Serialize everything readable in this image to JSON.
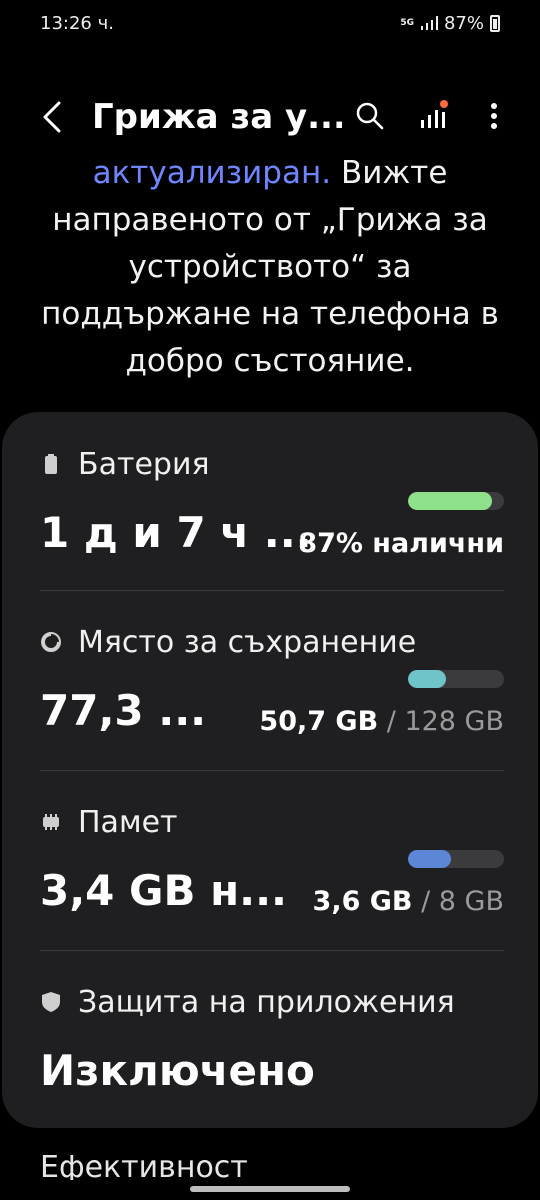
{
  "status": {
    "time": "13:26 ч.",
    "network": "5G",
    "battery": "87%"
  },
  "appbar": {
    "title": "Грижа за у...",
    "back_icon": "chevron-left-icon",
    "search_icon": "search-icon",
    "signal_icon": "diagnostics-icon",
    "more_icon": "more-vert-icon"
  },
  "intro": {
    "link_text": "актуализиран.",
    "text_after_link": " Вижте направеното от „Грижа за устройството“ за поддържане на телефона в добро състояние."
  },
  "sections": {
    "battery": {
      "label": "Батерия",
      "big": "1 д и 7 ч ...",
      "side": "87% налични",
      "level": 0.87,
      "color": "#8ee08a"
    },
    "storage": {
      "label": "Място за съхранение",
      "big": "77,3 ...",
      "used": "50,7 GB",
      "sep": " / ",
      "total": "128 GB",
      "level": 0.4,
      "color": "#6ec4c9"
    },
    "memory": {
      "label": "Памет",
      "big": "3,4 GB н...",
      "used": "3,6 GB",
      "sep": " / ",
      "total": "8 GB",
      "level": 0.45,
      "color": "#5b87d6"
    },
    "protection": {
      "label": "Защита на приложения",
      "big": "Изключено"
    }
  },
  "peek": {
    "label": "Ефективност"
  }
}
